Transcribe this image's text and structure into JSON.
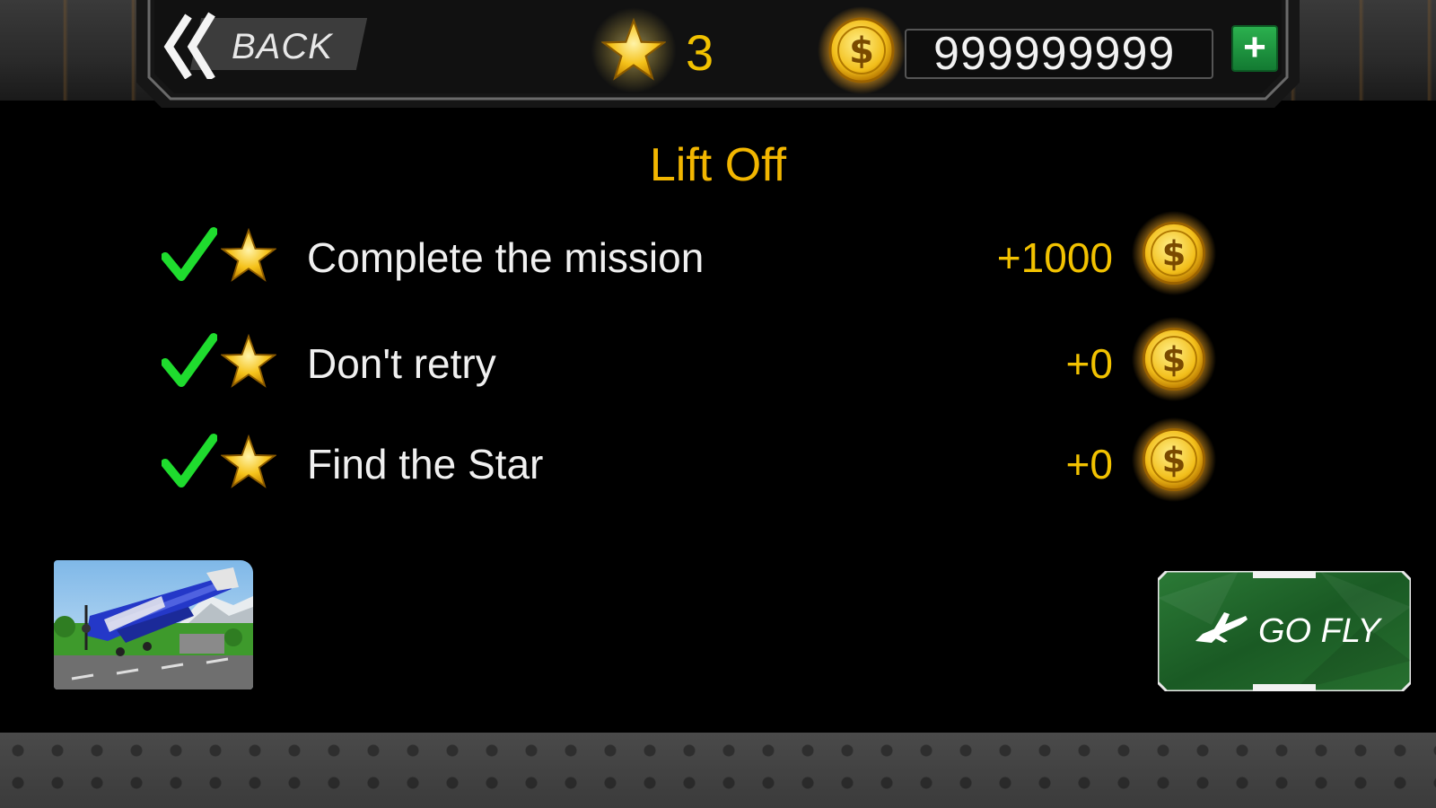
{
  "hud": {
    "back_label": "BACK",
    "stars": "3",
    "coins": "999999999",
    "add_label": "+"
  },
  "mission": {
    "title": "Lift Off",
    "objectives": [
      {
        "label": "Complete the mission",
        "reward": "+1000",
        "completed": true
      },
      {
        "label": "Don't retry",
        "reward": "+0",
        "completed": true
      },
      {
        "label": "Find the Star",
        "reward": "+0",
        "completed": true
      }
    ]
  },
  "actions": {
    "go_fly_label": "GO FLY"
  },
  "colors": {
    "gold": "#f2c200",
    "title_gold": "#f2b600",
    "check_green": "#1fdc2e",
    "button_green": "#1e6b2c",
    "plane_blue": "#2438c8"
  },
  "icons": {
    "back": "double-chevron-left-icon",
    "star": "star-icon",
    "coin": "dollar-coin-icon",
    "check": "checkmark-icon",
    "plane": "airplane-icon"
  }
}
